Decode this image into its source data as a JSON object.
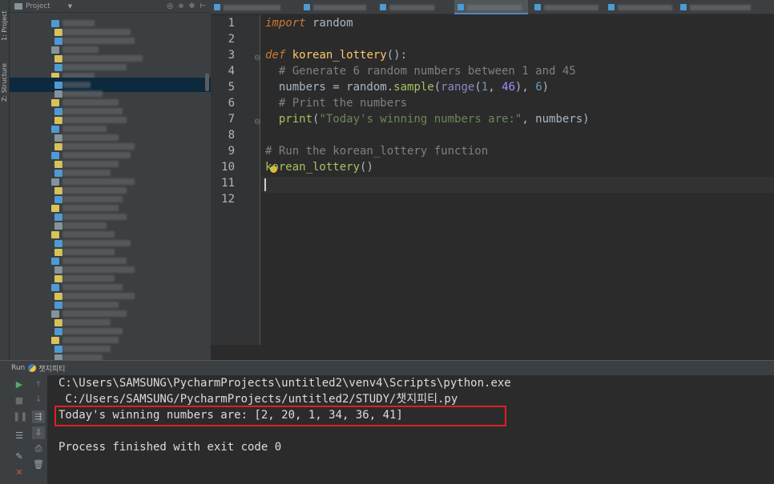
{
  "sidebar": {
    "project_tab": "1: Project",
    "structure_tab": "Z: Structure"
  },
  "project_panel": {
    "title": "Project"
  },
  "editor": {
    "line_numbers": [
      "1",
      "2",
      "3",
      "4",
      "5",
      "6",
      "7",
      "8",
      "9",
      "10",
      "11",
      "12"
    ],
    "lines": [
      [
        {
          "t": "import",
          "c": "kw-it"
        },
        {
          "t": " random",
          "c": "plain"
        }
      ],
      [],
      [
        {
          "t": "def",
          "c": "kw-it"
        },
        {
          "t": " ",
          "c": "plain"
        },
        {
          "t": "korean_lottery",
          "c": "fn"
        },
        {
          "t": "():",
          "c": "plain"
        }
      ],
      [
        {
          "t": "  # Generate 6 random numbers between 1 and 45",
          "c": "cm"
        }
      ],
      [
        {
          "t": "  numbers = random.",
          "c": "plain"
        },
        {
          "t": "sample",
          "c": "call"
        },
        {
          "t": "(",
          "c": "plain"
        },
        {
          "t": "range",
          "c": "bi"
        },
        {
          "t": "(",
          "c": "plain"
        },
        {
          "t": "1",
          "c": "num"
        },
        {
          "t": ", ",
          "c": "plain"
        },
        {
          "t": "46",
          "c": "num2"
        },
        {
          "t": "), ",
          "c": "plain"
        },
        {
          "t": "6",
          "c": "num"
        },
        {
          "t": ")",
          "c": "plain"
        }
      ],
      [
        {
          "t": "  # Print the numbers",
          "c": "cm"
        }
      ],
      [
        {
          "t": "  ",
          "c": "plain"
        },
        {
          "t": "print",
          "c": "call"
        },
        {
          "t": "(",
          "c": "plain"
        },
        {
          "t": "\"Today's winning numbers are:\"",
          "c": "str"
        },
        {
          "t": ", numbers)",
          "c": "plain"
        }
      ],
      [],
      [
        {
          "t": "# Run the korean_lottery function",
          "c": "cm"
        }
      ],
      [
        {
          "t": "korean_lottery",
          "c": "call"
        },
        {
          "t": "()",
          "c": "plain"
        }
      ],
      [],
      []
    ]
  },
  "run_panel": {
    "label": "Run",
    "config_name": "챗지피티",
    "console_lines": [
      "C:\\Users\\SAMSUNG\\PycharmProjects\\untitled2\\venv4\\Scripts\\python.exe",
      " C:/Users/SAMSUNG/PycharmProjects/untitled2/STUDY/챗지피티.py",
      "Today's winning numbers are: [2, 20, 1, 34, 36, 41]",
      "",
      "Process finished with exit code 0"
    ]
  },
  "colors": {
    "highlight_box": "#e02020",
    "run_green": "#59a869",
    "stop_red": "#c75450"
  }
}
